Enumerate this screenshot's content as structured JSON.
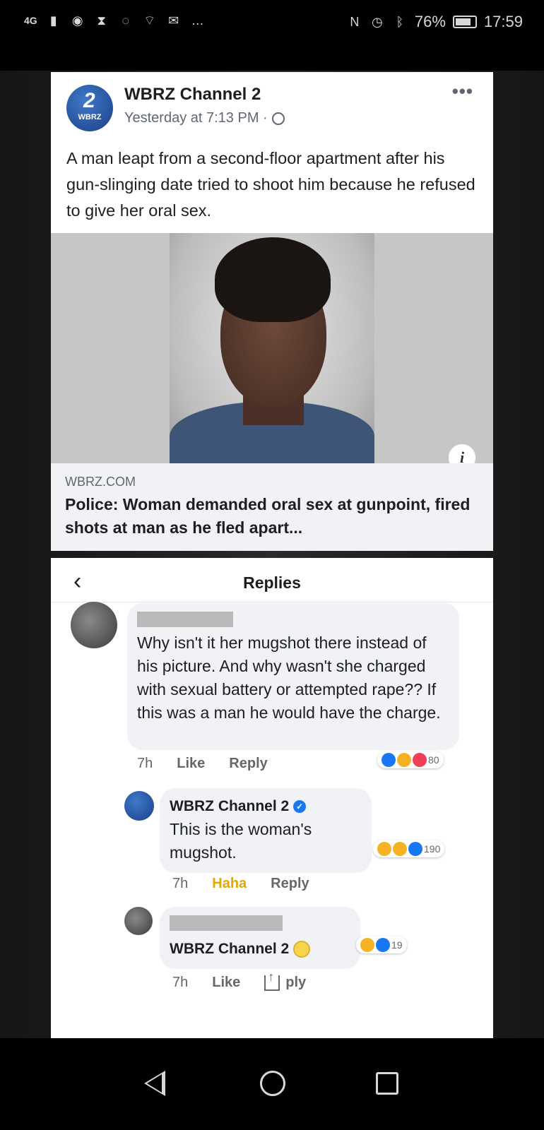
{
  "status_bar": {
    "network": "4G",
    "battery": "76%",
    "time": "17:59"
  },
  "post": {
    "page_name": "WBRZ Channel 2",
    "avatar_number": "2",
    "avatar_label": "WBRZ",
    "timestamp": "Yesterday at 7:13 PM ·",
    "more": "•••",
    "text": "A man leapt from a second-floor apartment after his gun-slinging date tried to shoot him because he refused to give her oral sex.",
    "link": {
      "domain": "WBRZ.COM",
      "title": "Police: Woman demanded oral sex at gunpoint, fired shots at man as he fled apart..."
    },
    "info_icon": "i"
  },
  "replies": {
    "back": "‹",
    "title": "Replies",
    "comments": [
      {
        "text": "Why isn't it her mugshot there instead of his picture. And why wasn't she charged with sexual battery or attempted rape?? If this was a man he would have the charge.",
        "time": "7h",
        "action1": "Like",
        "action2": "Reply",
        "reaction_count": "80"
      },
      {
        "name": "WBRZ Channel 2",
        "text": "This is the woman's mugshot.",
        "time": "7h",
        "action1": "Haha",
        "action2": "Reply",
        "reaction_count": "190"
      },
      {
        "name": "WBRZ Channel 2",
        "time": "7h",
        "action1": "Like",
        "action2": "ply",
        "reaction_count": "19"
      }
    ]
  },
  "nav": {
    "back": "back",
    "home": "home",
    "recents": "recents"
  }
}
